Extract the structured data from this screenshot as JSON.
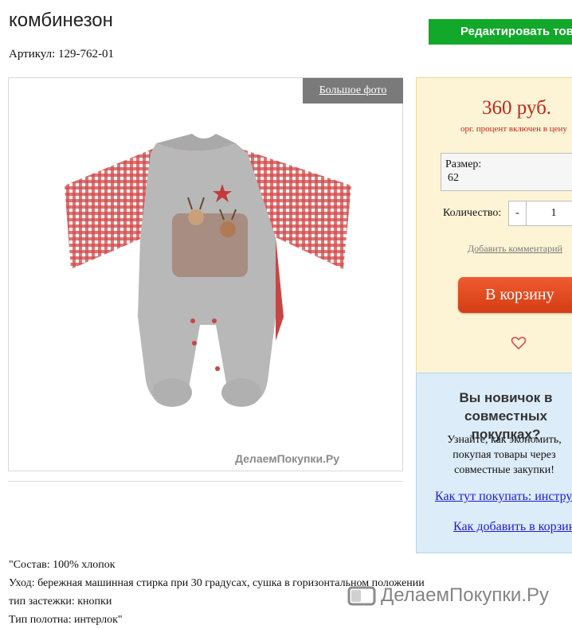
{
  "product": {
    "title": "комбинезон",
    "sku": "Артикул: 129-762-01",
    "edit_button": "Редактировать товар"
  },
  "photo": {
    "big_photo_label": "Большое фото",
    "watermark": "ДелаемПокупки.Ру"
  },
  "buy": {
    "price": "360 руб.",
    "price_note": "орг. процент включен в цену",
    "size_label": "Размер:",
    "size_value": "62",
    "qty_label": "Количество:",
    "qty_minus": "-",
    "qty_value": "1",
    "comment_link": "Добавить комментарий",
    "cart_button": "В корзину"
  },
  "info": {
    "title": "Вы новичок в совместных покупках?",
    "text": "Узнайте, как экономить, покупая товары через совместные закупки!",
    "link1": "Как тут покупать: инструкция",
    "link2": "Как добавить в корзину"
  },
  "description": [
    "\"Состав: 100% хлопок",
    "Уход: бережная машинная стирка при 30 градусах, сушка в горизонтальном положении",
    "тип застежки: кнопки",
    "Тип полотна: интерлок\""
  ],
  "footer_watermark": "ДелаемПокупки.Ру",
  "colors": {
    "edit_green": "#12a82a",
    "price_red": "#c4261b",
    "cart_orange": "#e24a20",
    "link_blue": "#1a1ad6",
    "panel_yellow": "#fdf4d6",
    "panel_blue": "#dcecf9"
  }
}
